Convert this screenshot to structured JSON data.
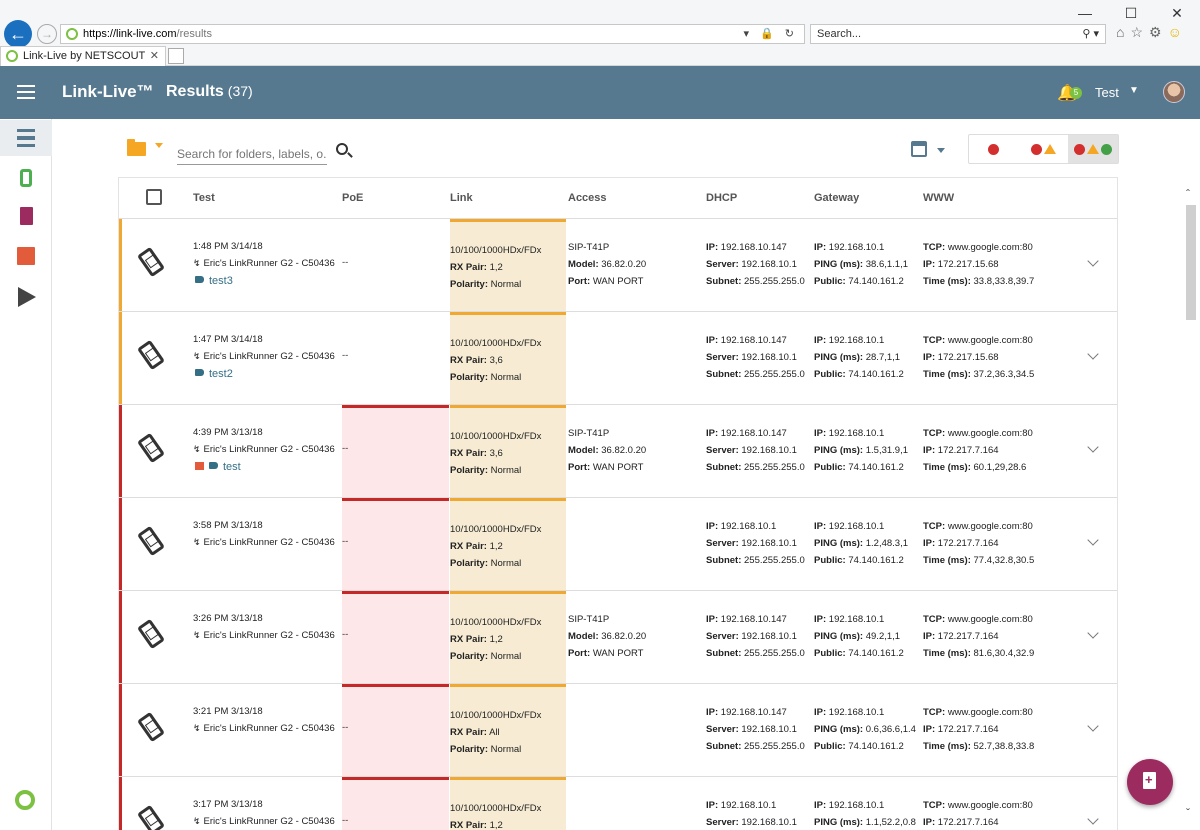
{
  "browser": {
    "url_domain": "https://link-live.com",
    "url_path": "/results",
    "search_placeholder": "Search...",
    "tab_title": "Link-Live by NETSCOUT"
  },
  "app": {
    "brand": "Link-Live™",
    "page_title": "Results",
    "result_count": "(37)",
    "notification_count": "5",
    "user_name": "Test"
  },
  "toolbar": {
    "search_placeholder": "Search for folders, labels, o..."
  },
  "table": {
    "columns": [
      "Test",
      "PoE",
      "Link",
      "Access",
      "DHCP",
      "Gateway",
      "WWW"
    ],
    "rows": [
      {
        "status": "warning",
        "time": "1:48 PM   3/14/18",
        "device": "Eric's LinkRunner G2 - C50436",
        "label": "test3",
        "label_image": false,
        "poe": "--",
        "link_speed": "10/100/1000HDx/FDx",
        "rx_pair": "1,2",
        "polarity": "Normal",
        "access_name": "SIP-T41P",
        "access_model": "36.82.0.20",
        "access_port": "WAN PORT",
        "dhcp_ip": "192.168.10.147",
        "dhcp_server": "192.168.10.1",
        "dhcp_subnet": "255.255.255.0",
        "gw_ip": "192.168.10.1",
        "gw_ping": "38.6,1.1,1",
        "gw_public": "74.140.161.2",
        "www_tcp": "www.google.com:80",
        "www_ip": "172.217.15.68",
        "www_time": "33.8,33.8,39.7"
      },
      {
        "status": "warning",
        "time": "1:47 PM   3/14/18",
        "device": "Eric's LinkRunner G2 - C50436",
        "label": "test2",
        "label_image": false,
        "poe": "--",
        "link_speed": "10/100/1000HDx/FDx",
        "rx_pair": "3,6",
        "polarity": "Normal",
        "access_name": "",
        "access_model": "",
        "access_port": "",
        "dhcp_ip": "192.168.10.147",
        "dhcp_server": "192.168.10.1",
        "dhcp_subnet": "255.255.255.0",
        "gw_ip": "192.168.10.1",
        "gw_ping": "28.7,1,1",
        "gw_public": "74.140.161.2",
        "www_tcp": "www.google.com:80",
        "www_ip": "172.217.15.68",
        "www_time": "37.2,36.3,34.5"
      },
      {
        "status": "error",
        "time": "4:39 PM   3/13/18",
        "device": "Eric's LinkRunner G2 - C50436",
        "label": "test",
        "label_image": true,
        "poe": "--",
        "link_speed": "10/100/1000HDx/FDx",
        "rx_pair": "3,6",
        "polarity": "Normal",
        "access_name": "SIP-T41P",
        "access_model": "36.82.0.20",
        "access_port": "WAN PORT",
        "dhcp_ip": "192.168.10.147",
        "dhcp_server": "192.168.10.1",
        "dhcp_subnet": "255.255.255.0",
        "gw_ip": "192.168.10.1",
        "gw_ping": "1.5,31.9,1",
        "gw_public": "74.140.161.2",
        "www_tcp": "www.google.com:80",
        "www_ip": "172.217.7.164",
        "www_time": "60.1,29,28.6"
      },
      {
        "status": "error",
        "time": "3:58 PM   3/13/18",
        "device": "Eric's LinkRunner G2 - C50436",
        "label": "",
        "label_image": false,
        "poe": "--",
        "link_speed": "10/100/1000HDx/FDx",
        "rx_pair": "1,2",
        "polarity": "Normal",
        "access_name": "",
        "access_model": "",
        "access_port": "",
        "dhcp_ip": "192.168.10.1",
        "dhcp_server": "192.168.10.1",
        "dhcp_subnet": "255.255.255.0",
        "gw_ip": "192.168.10.1",
        "gw_ping": "1.2,48.3,1",
        "gw_public": "74.140.161.2",
        "www_tcp": "www.google.com:80",
        "www_ip": "172.217.7.164",
        "www_time": "77.4,32.8,30.5"
      },
      {
        "status": "error",
        "time": "3:26 PM   3/13/18",
        "device": "Eric's LinkRunner G2 - C50436",
        "label": "",
        "label_image": false,
        "poe": "--",
        "link_speed": "10/100/1000HDx/FDx",
        "rx_pair": "1,2",
        "polarity": "Normal",
        "access_name": "SIP-T41P",
        "access_model": "36.82.0.20",
        "access_port": "WAN PORT",
        "dhcp_ip": "192.168.10.147",
        "dhcp_server": "192.168.10.1",
        "dhcp_subnet": "255.255.255.0",
        "gw_ip": "192.168.10.1",
        "gw_ping": "49.2,1,1",
        "gw_public": "74.140.161.2",
        "www_tcp": "www.google.com:80",
        "www_ip": "172.217.7.164",
        "www_time": "81.6,30.4,32.9"
      },
      {
        "status": "error",
        "time": "3:21 PM   3/13/18",
        "device": "Eric's LinkRunner G2 - C50436",
        "label": "",
        "label_image": false,
        "poe": "--",
        "link_speed": "10/100/1000HDx/FDx",
        "rx_pair": "All",
        "polarity": "Normal",
        "access_name": "",
        "access_model": "",
        "access_port": "",
        "dhcp_ip": "192.168.10.147",
        "dhcp_server": "192.168.10.1",
        "dhcp_subnet": "255.255.255.0",
        "gw_ip": "192.168.10.1",
        "gw_ping": "0.6,36.6,1.4",
        "gw_public": "74.140.161.2",
        "www_tcp": "www.google.com:80",
        "www_ip": "172.217.7.164",
        "www_time": "52.7,38.8,33.8"
      },
      {
        "status": "error",
        "time": "3:17 PM   3/13/18",
        "device": "Eric's LinkRunner G2 - C50436",
        "label": "",
        "label_image": false,
        "poe": "--",
        "link_speed": "10/100/1000HDx/FDx",
        "rx_pair": "1,2",
        "polarity": "",
        "access_name": "",
        "access_model": "",
        "access_port": "",
        "dhcp_ip": "192.168.10.1",
        "dhcp_server": "192.168.10.1",
        "dhcp_subnet": "",
        "gw_ip": "192.168.10.1",
        "gw_ping": "1.1,52.2,0.8",
        "gw_public": "",
        "www_tcp": "www.google.com:80",
        "www_ip": "172.217.7.164",
        "www_time": ""
      }
    ]
  },
  "field_labels": {
    "rx_pair": "RX Pair:",
    "polarity": "Polarity:",
    "model": "Model:",
    "port": "Port:",
    "ip": "IP:",
    "server": "Server:",
    "subnet": "Subnet:",
    "ping": "PING (ms):",
    "public": "Public:",
    "tcp": "TCP:",
    "time": "Time (ms):"
  },
  "colors": {
    "header_bg": "#56798f",
    "warning": "#f0a830",
    "error": "#c62828",
    "poe_error_bg": "#fde7e9",
    "link_bg": "#f7ecd3",
    "accent_green": "#7cc142",
    "fab": "#9c2b5f"
  }
}
